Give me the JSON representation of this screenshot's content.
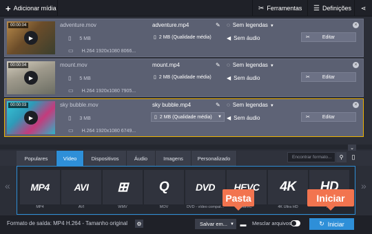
{
  "toolbar": {
    "add_media": "Adicionar mídia",
    "tools": "Ferramentas",
    "settings": "Definições"
  },
  "files": [
    {
      "duration": "00:00:04",
      "source_name": "adventure.mov",
      "source_size": "5 MB",
      "source_codec": "H.264 1920x1080 8066...",
      "output_name": "adventure.mp4",
      "output_size": "2 MB (Qualidade média)",
      "subtitles": "Sem legendas",
      "audio": "Sem áudio",
      "edit": "Editar"
    },
    {
      "duration": "00:00:04",
      "source_name": "mount.mov",
      "source_size": "5 MB",
      "source_codec": "H.264 1920x1080 7905...",
      "output_name": "mount.mp4",
      "output_size": "2 MB (Qualidade média)",
      "subtitles": "Sem legendas",
      "audio": "Sem áudio",
      "edit": "Editar"
    },
    {
      "duration": "00:00:03",
      "source_name": "sky bubble.mov",
      "source_size": "3 MB",
      "source_codec": "H.264 1920x1080 6749...",
      "output_name": "sky bubble.mp4",
      "output_size": "2 MB (Qualidade média)",
      "subtitles": "Sem legendas",
      "audio": "Sem áudio",
      "edit": "Editar"
    }
  ],
  "tabs": [
    "Populares",
    "Vídeo",
    "Dispositivos",
    "Áudio",
    "Imagens",
    "Personalizado"
  ],
  "active_tab": "Vídeo",
  "search": {
    "placeholder": "Encontrar formato..."
  },
  "formats": [
    {
      "logo": "MP4",
      "label": "MP4"
    },
    {
      "logo": "AVI",
      "label": "AVI"
    },
    {
      "logo": "⊞",
      "label": "WMV"
    },
    {
      "logo": "Q",
      "label": "MOV"
    },
    {
      "logo": "DVD",
      "label": "DVD - vídeo compat..."
    },
    {
      "logo": "HEVC",
      "label": "HEVC"
    },
    {
      "logo": "4K",
      "label": "4K Ultra HD"
    },
    {
      "logo": "HD",
      "label": "HD"
    }
  ],
  "bottom": {
    "output_format": "Formato de saída: MP4 H.264 - Tamanho original",
    "save_to": "Salvar em...",
    "merge": "Mesclar arquivos",
    "convert": "Iniciar"
  },
  "callouts": {
    "folder": "Pasta",
    "convert": "Iniciar"
  },
  "colors": {
    "accent": "#2e8fd8",
    "selection": "#f0b400",
    "callout": "#f2744f"
  }
}
